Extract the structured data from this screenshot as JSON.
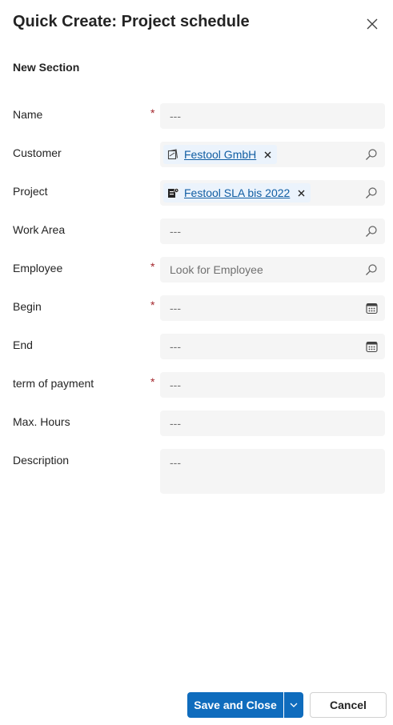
{
  "header": {
    "title": "Quick Create: Project schedule",
    "close_icon": "close-icon"
  },
  "section": {
    "title": "New Section"
  },
  "fields": {
    "name": {
      "label": "Name",
      "required": "*",
      "value": "---"
    },
    "customer": {
      "label": "Customer",
      "value": "Festool GmbH",
      "icon": "account-icon"
    },
    "project": {
      "label": "Project",
      "value": "Festool SLA bis 2022",
      "icon": "project-icon"
    },
    "work_area": {
      "label": "Work Area",
      "value": "---"
    },
    "employee": {
      "label": "Employee",
      "required": "*",
      "placeholder": "Look for Employee"
    },
    "begin": {
      "label": "Begin",
      "required": "*",
      "value": "---"
    },
    "end": {
      "label": "End",
      "value": "---"
    },
    "term_of_payment": {
      "label": "term of payment",
      "required": "*",
      "value": "---"
    },
    "max_hours": {
      "label": "Max. Hours",
      "value": "---"
    },
    "description": {
      "label": "Description",
      "value": "---"
    }
  },
  "footer": {
    "save_label": "Save and Close",
    "cancel_label": "Cancel"
  },
  "colors": {
    "accent": "#0f6cbd",
    "required": "#a4262c",
    "link": "#115ea3",
    "field_background": "#f5f5f5"
  }
}
